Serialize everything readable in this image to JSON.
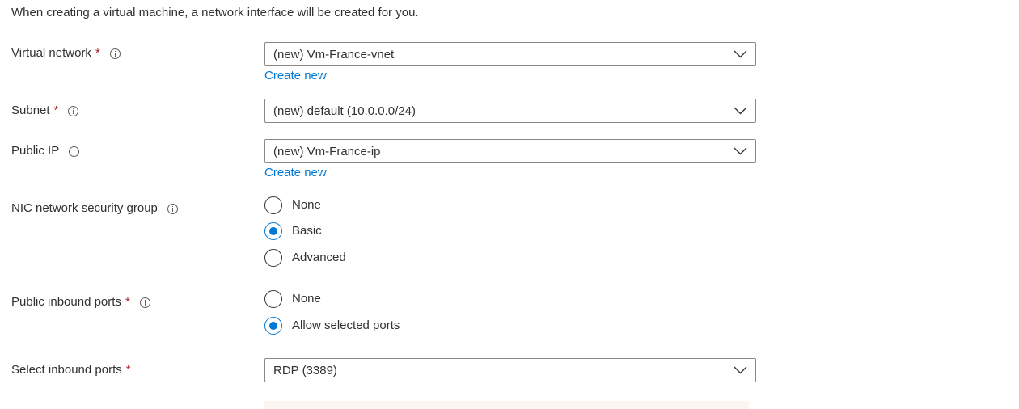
{
  "intro_text": "When creating a virtual machine, a network interface will be created for you.",
  "colors": {
    "accent": "#0078d4",
    "required": "#a4262c",
    "text": "#323130",
    "border": "#8a8886"
  },
  "fields": {
    "virtual_network": {
      "label": "Virtual network",
      "required_mark": "*",
      "value": "(new) Vm-France-vnet",
      "create_new": "Create new"
    },
    "subnet": {
      "label": "Subnet",
      "required_mark": "*",
      "value": "(new) default (10.0.0.0/24)"
    },
    "public_ip": {
      "label": "Public IP",
      "value": "(new) Vm-France-ip",
      "create_new": "Create new"
    },
    "nic_nsg": {
      "label": "NIC network security group",
      "options": [
        "None",
        "Basic",
        "Advanced"
      ],
      "selected": "Basic"
    },
    "public_inbound_ports": {
      "label": "Public inbound ports",
      "required_mark": "*",
      "options": [
        "None",
        "Allow selected ports"
      ],
      "selected": "Allow selected ports"
    },
    "select_inbound_ports": {
      "label": "Select inbound ports",
      "required_mark": "*",
      "value": "RDP (3389)"
    }
  },
  "icons": {
    "info": "info-icon",
    "dropdown": "chevron-down-icon"
  }
}
